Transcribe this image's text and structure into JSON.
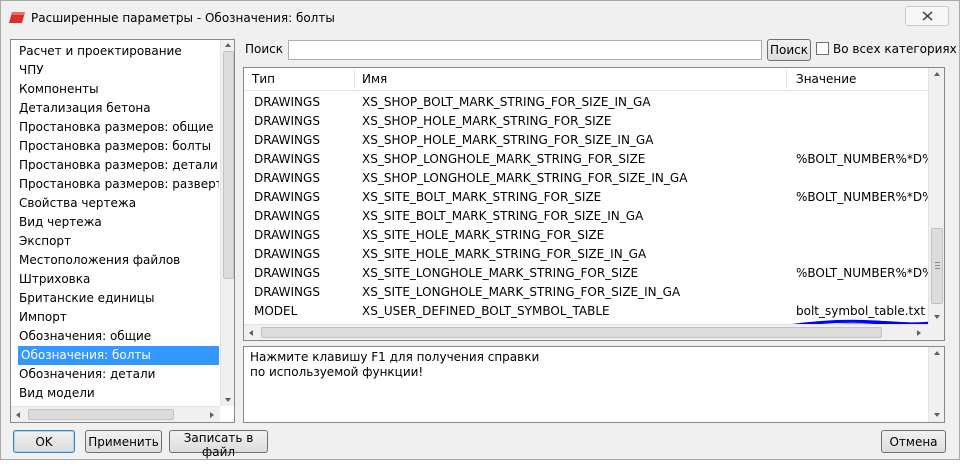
{
  "window": {
    "title": "Расширенные параметры - Обозначения: болты"
  },
  "categories": [
    {
      "label": "Расчет и проектирование"
    },
    {
      "label": "ЧПУ"
    },
    {
      "label": "Компоненты"
    },
    {
      "label": "Детализация бетона"
    },
    {
      "label": "Простановка размеров: общие"
    },
    {
      "label": "Простановка размеров: болты"
    },
    {
      "label": "Простановка размеров: детали"
    },
    {
      "label": "Простановка размеров: развертывания"
    },
    {
      "label": "Свойства чертежа"
    },
    {
      "label": "Вид чертежа"
    },
    {
      "label": "Экспорт"
    },
    {
      "label": "Местоположения файлов"
    },
    {
      "label": "Штриховка"
    },
    {
      "label": "Британские единицы"
    },
    {
      "label": "Импорт"
    },
    {
      "label": "Обозначения: общие"
    },
    {
      "label": "Обозначения: болты",
      "selected": true
    },
    {
      "label": "Обозначения: детали"
    },
    {
      "label": "Вид модели"
    }
  ],
  "search": {
    "label": "Поиск",
    "value": "",
    "button": "Поиск",
    "all_categories_label": "Во всех категориях",
    "all_categories_checked": false
  },
  "table": {
    "columns": [
      "Тип",
      "Имя",
      "Значение"
    ],
    "rows": [
      {
        "type": "DRAWINGS",
        "name": "XS_SHOP_BOLT_MARK_STRING_FOR_SIZE_IN_GA",
        "value": ""
      },
      {
        "type": "DRAWINGS",
        "name": "XS_SHOP_HOLE_MARK_STRING_FOR_SIZE",
        "value": ""
      },
      {
        "type": "DRAWINGS",
        "name": "XS_SHOP_HOLE_MARK_STRING_FOR_SIZE_IN_GA",
        "value": ""
      },
      {
        "type": "DRAWINGS",
        "name": "XS_SHOP_LONGHOLE_MARK_STRING_FOR_SIZE",
        "value": "%BOLT_NUMBER%*D%H"
      },
      {
        "type": "DRAWINGS",
        "name": "XS_SHOP_LONGHOLE_MARK_STRING_FOR_SIZE_IN_GA",
        "value": ""
      },
      {
        "type": "DRAWINGS",
        "name": "XS_SITE_BOLT_MARK_STRING_FOR_SIZE",
        "value": "%BOLT_NUMBER%*D%H"
      },
      {
        "type": "DRAWINGS",
        "name": "XS_SITE_BOLT_MARK_STRING_FOR_SIZE_IN_GA",
        "value": ""
      },
      {
        "type": "DRAWINGS",
        "name": "XS_SITE_HOLE_MARK_STRING_FOR_SIZE",
        "value": ""
      },
      {
        "type": "DRAWINGS",
        "name": "XS_SITE_HOLE_MARK_STRING_FOR_SIZE_IN_GA",
        "value": ""
      },
      {
        "type": "DRAWINGS",
        "name": "XS_SITE_LONGHOLE_MARK_STRING_FOR_SIZE",
        "value": "%BOLT_NUMBER%*D%H"
      },
      {
        "type": "DRAWINGS",
        "name": "XS_SITE_LONGHOLE_MARK_STRING_FOR_SIZE_IN_GA",
        "value": ""
      },
      {
        "type": "MODEL",
        "name": "XS_USER_DEFINED_BOLT_SYMBOL_TABLE",
        "value": "bolt_symbol_table.txt"
      }
    ]
  },
  "help": {
    "line1": "Нажмите клавишу F1 для получения справки",
    "line2": "по используемой функции!"
  },
  "buttons": {
    "ok": "OK",
    "apply": "Применить",
    "write": "Записать в файл",
    "cancel": "Отмена"
  },
  "colors": {
    "selection": "#3399ff",
    "annotation": "#0000ff"
  }
}
